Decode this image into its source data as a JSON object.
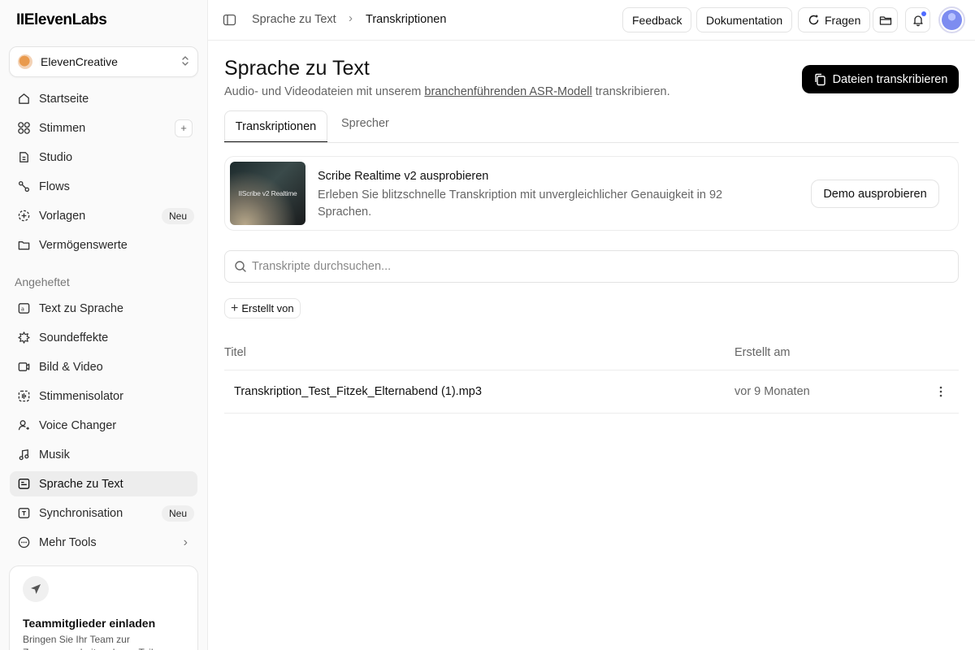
{
  "app": {
    "logo": "IIElevenLabs"
  },
  "workspace": {
    "name": "ElevenCreative"
  },
  "sidebar": {
    "items": [
      {
        "label": "Startseite"
      },
      {
        "label": "Stimmen"
      },
      {
        "label": "Studio"
      },
      {
        "label": "Flows"
      },
      {
        "label": "Vorlagen",
        "badge": "Neu"
      },
      {
        "label": "Vermögenswerte"
      }
    ],
    "pinned_label": "Angeheftet",
    "pinned": [
      {
        "label": "Text zu Sprache"
      },
      {
        "label": "Soundeffekte"
      },
      {
        "label": "Bild & Video"
      },
      {
        "label": "Stimmenisolator"
      },
      {
        "label": "Voice Changer"
      },
      {
        "label": "Musik"
      },
      {
        "label": "Sprache zu Text",
        "active": true
      },
      {
        "label": "Synchronisation",
        "badge": "Neu"
      },
      {
        "label": "Mehr Tools"
      }
    ],
    "invite": {
      "title": "Teammitglieder einladen",
      "text": "Bringen Sie Ihr Team zur Zusammenarbeit und zum Teilen"
    }
  },
  "topbar": {
    "breadcrumb": [
      "Sprache zu Text",
      "Transkriptionen"
    ],
    "feedback": "Feedback",
    "docs": "Dokumentation",
    "ask": "Fragen"
  },
  "main": {
    "title": "Sprache zu Text",
    "subtitle_pre": "Audio- und Videodateien mit unserem ",
    "subtitle_link": "branchenführenden ASR-Modell",
    "subtitle_post": " transkribieren.",
    "primary_button": "Dateien transkribieren",
    "tabs": [
      {
        "label": "Transkriptionen",
        "active": true
      },
      {
        "label": "Sprecher"
      }
    ],
    "promo": {
      "thumb_text": "IIScribe v2 Realtime",
      "title": "Scribe Realtime v2 ausprobieren",
      "text": "Erleben Sie blitzschnelle Transkription mit unvergleichlicher Genauigkeit in 92 Sprachen.",
      "button": "Demo ausprobieren"
    },
    "search": {
      "placeholder": "Transkripte durchsuchen...",
      "value": ""
    },
    "filter": {
      "label": "Erstellt von"
    },
    "table": {
      "columns": [
        "Titel",
        "Erstellt am"
      ],
      "rows": [
        {
          "title": "Transkription_Test_Fitzek_Elternabend (1).mp3",
          "created": "vor 9 Monaten"
        }
      ]
    }
  },
  "colors": {
    "primary": "#000000",
    "notification_dot": "#4f6bff",
    "active_nav": "#ededed"
  }
}
